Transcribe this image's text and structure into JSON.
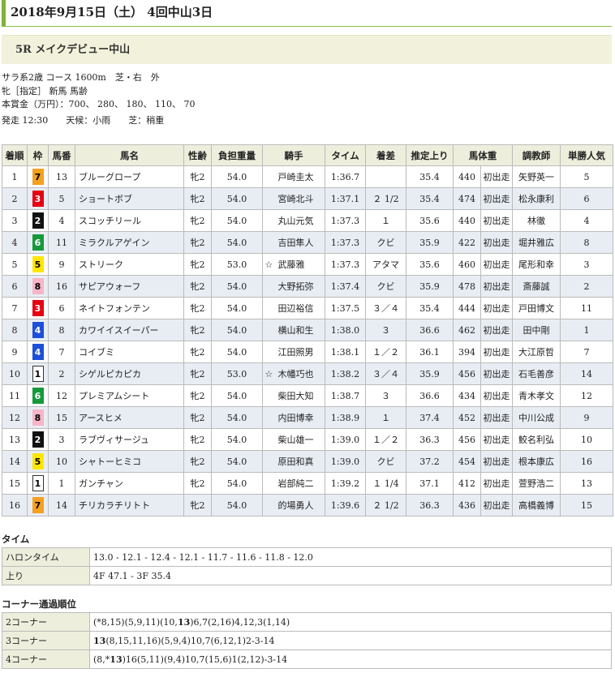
{
  "header": {
    "title": "2018年9月15日（土） 4回中山3日"
  },
  "race": {
    "title": "5R メイクデビュー中山",
    "info_lines": [
      "サラ系2歳 コース 1600m　芝・右　外",
      "牝［指定］ 新馬 馬齢",
      "本賞金（万円）：700、 280、 180、 110、 70",
      "発走 12:30　　天候：小雨　　芝：稍重"
    ]
  },
  "results": {
    "columns": [
      "着順",
      "枠",
      "馬番",
      "馬名",
      "性齢",
      "負担重量",
      "騎手",
      "タイム",
      "着差",
      "推定上り",
      "馬体重",
      "",
      "調教師",
      "単勝人気"
    ],
    "rows": [
      {
        "pos": "1",
        "waku": "7",
        "num": "13",
        "name": "ブルーグロープ",
        "sex": "牝2",
        "weight": "54.0",
        "mark": "",
        "jockey": "戸崎圭太",
        "time": "1:36.7",
        "margin": "",
        "last3f": "35.4",
        "body": "440",
        "bodychg": "初出走",
        "trainer": "矢野英一",
        "pop": "5"
      },
      {
        "pos": "2",
        "waku": "3",
        "num": "5",
        "name": "ショートボブ",
        "sex": "牝2",
        "weight": "54.0",
        "mark": "",
        "jockey": "宮崎北斗",
        "time": "1:37.1",
        "margin": "２ 1/2",
        "last3f": "35.4",
        "body": "474",
        "bodychg": "初出走",
        "trainer": "松永康利",
        "pop": "6"
      },
      {
        "pos": "3",
        "waku": "2",
        "num": "4",
        "name": "スコッチリール",
        "sex": "牝2",
        "weight": "54.0",
        "mark": "",
        "jockey": "丸山元気",
        "time": "1:37.3",
        "margin": "１",
        "last3f": "35.6",
        "body": "440",
        "bodychg": "初出走",
        "trainer": "林徹",
        "pop": "4"
      },
      {
        "pos": "4",
        "waku": "6",
        "num": "11",
        "name": "ミラクルアゲイン",
        "sex": "牝2",
        "weight": "54.0",
        "mark": "",
        "jockey": "吉田隼人",
        "time": "1:37.3",
        "margin": "クビ",
        "last3f": "35.9",
        "body": "422",
        "bodychg": "初出走",
        "trainer": "堀井雅広",
        "pop": "8"
      },
      {
        "pos": "5",
        "waku": "5",
        "num": "9",
        "name": "ストリーク",
        "sex": "牝2",
        "weight": "53.0",
        "mark": "☆",
        "jockey": "武藤雅",
        "time": "1:37.3",
        "margin": "アタマ",
        "last3f": "35.6",
        "body": "460",
        "bodychg": "初出走",
        "trainer": "尾形和幸",
        "pop": "3"
      },
      {
        "pos": "6",
        "waku": "8",
        "num": "16",
        "name": "サピアウォーフ",
        "sex": "牝2",
        "weight": "54.0",
        "mark": "",
        "jockey": "大野拓弥",
        "time": "1:37.4",
        "margin": "クビ",
        "last3f": "35.9",
        "body": "478",
        "bodychg": "初出走",
        "trainer": "斎藤誠",
        "pop": "2"
      },
      {
        "pos": "7",
        "waku": "3",
        "num": "6",
        "name": "ネイトフォンテン",
        "sex": "牝2",
        "weight": "54.0",
        "mark": "",
        "jockey": "田辺裕信",
        "time": "1:37.5",
        "margin": "３／４",
        "last3f": "35.4",
        "body": "444",
        "bodychg": "初出走",
        "trainer": "戸田博文",
        "pop": "11"
      },
      {
        "pos": "8",
        "waku": "4",
        "num": "8",
        "name": "カワイイスイーパー",
        "sex": "牝2",
        "weight": "54.0",
        "mark": "",
        "jockey": "横山和生",
        "time": "1:38.0",
        "margin": "３",
        "last3f": "36.6",
        "body": "462",
        "bodychg": "初出走",
        "trainer": "田中剛",
        "pop": "1"
      },
      {
        "pos": "9",
        "waku": "4",
        "num": "7",
        "name": "コイブミ",
        "sex": "牝2",
        "weight": "54.0",
        "mark": "",
        "jockey": "江田照男",
        "time": "1:38.1",
        "margin": "１／２",
        "last3f": "36.1",
        "body": "394",
        "bodychg": "初出走",
        "trainer": "大江原哲",
        "pop": "7"
      },
      {
        "pos": "10",
        "waku": "1",
        "num": "2",
        "name": "シゲルピカピカ",
        "sex": "牝2",
        "weight": "53.0",
        "mark": "☆",
        "jockey": "木幡巧也",
        "time": "1:38.2",
        "margin": "３／４",
        "last3f": "35.9",
        "body": "456",
        "bodychg": "初出走",
        "trainer": "石毛善彦",
        "pop": "14"
      },
      {
        "pos": "11",
        "waku": "6",
        "num": "12",
        "name": "プレミアムシート",
        "sex": "牝2",
        "weight": "54.0",
        "mark": "",
        "jockey": "柴田大知",
        "time": "1:38.7",
        "margin": "３",
        "last3f": "36.6",
        "body": "434",
        "bodychg": "初出走",
        "trainer": "青木孝文",
        "pop": "12"
      },
      {
        "pos": "12",
        "waku": "8",
        "num": "15",
        "name": "アースヒメ",
        "sex": "牝2",
        "weight": "54.0",
        "mark": "",
        "jockey": "内田博幸",
        "time": "1:38.9",
        "margin": "１",
        "last3f": "37.4",
        "body": "452",
        "bodychg": "初出走",
        "trainer": "中川公成",
        "pop": "9"
      },
      {
        "pos": "13",
        "waku": "2",
        "num": "3",
        "name": "ラブヴィサージュ",
        "sex": "牝2",
        "weight": "54.0",
        "mark": "",
        "jockey": "柴山雄一",
        "time": "1:39.0",
        "margin": "１／２",
        "last3f": "36.3",
        "body": "456",
        "bodychg": "初出走",
        "trainer": "鮫名利弘",
        "pop": "10"
      },
      {
        "pos": "14",
        "waku": "5",
        "num": "10",
        "name": "シャトーヒミコ",
        "sex": "牝2",
        "weight": "54.0",
        "mark": "",
        "jockey": "原田和真",
        "time": "1:39.0",
        "margin": "クビ",
        "last3f": "37.2",
        "body": "454",
        "bodychg": "初出走",
        "trainer": "根本康広",
        "pop": "16"
      },
      {
        "pos": "15",
        "waku": "1",
        "num": "1",
        "name": "ガンチャン",
        "sex": "牝2",
        "weight": "54.0",
        "mark": "",
        "jockey": "岩部純二",
        "time": "1:39.2",
        "margin": "１ 1/4",
        "last3f": "37.1",
        "body": "412",
        "bodychg": "初出走",
        "trainer": "萱野浩二",
        "pop": "13"
      },
      {
        "pos": "16",
        "waku": "7",
        "num": "14",
        "name": "チリカラチリトト",
        "sex": "牝2",
        "weight": "54.0",
        "mark": "",
        "jockey": "的場勇人",
        "time": "1:39.6",
        "margin": "２ 1/2",
        "last3f": "36.3",
        "body": "436",
        "bodychg": "初出走",
        "trainer": "高橋義博",
        "pop": "15"
      }
    ]
  },
  "waku_colors": {
    "1": {
      "bg": "#ffffff",
      "fg": "#000000",
      "border": "#333333"
    },
    "2": {
      "bg": "#111111",
      "fg": "#ffffff",
      "border": "#111111"
    },
    "3": {
      "bg": "#e60012",
      "fg": "#ffffff",
      "border": "#e60012"
    },
    "4": {
      "bg": "#1d4fd8",
      "fg": "#ffffff",
      "border": "#1d4fd8"
    },
    "5": {
      "bg": "#ffe600",
      "fg": "#000000",
      "border": "#ffe600"
    },
    "6": {
      "bg": "#149a3b",
      "fg": "#ffffff",
      "border": "#149a3b"
    },
    "7": {
      "bg": "#f5a01e",
      "fg": "#000000",
      "border": "#f5a01e"
    },
    "8": {
      "bg": "#f7b5c8",
      "fg": "#000000",
      "border": "#f7b5c8"
    }
  },
  "time_section": {
    "title": "タイム",
    "rows": [
      {
        "label": "ハロンタイム",
        "value": "13.0 - 12.1 - 12.4 - 12.1 - 11.7 - 11.6 - 11.8 - 12.0"
      },
      {
        "label": "上り",
        "value": "4F 47.1 - 3F 35.4"
      }
    ]
  },
  "corner_section": {
    "title": "コーナー通過順位",
    "rows": [
      {
        "label": "2コーナー",
        "parts": [
          {
            "t": "(*8,15)(5,9,11)(10,",
            "b": false
          },
          {
            "t": "13",
            "b": true
          },
          {
            "t": ")6,7(2,16)4,12,3(1,14)",
            "b": false
          }
        ]
      },
      {
        "label": "3コーナー",
        "parts": [
          {
            "t": "13",
            "b": true
          },
          {
            "t": "(8,15,11,16)(5,9,4)10,7(6,12,1)2-3-14",
            "b": false
          }
        ]
      },
      {
        "label": "4コーナー",
        "parts": [
          {
            "t": "(8,*",
            "b": false
          },
          {
            "t": "13",
            "b": true
          },
          {
            "t": ")16(5,11)(9,4)10,7(15,6)1(2,12)-3-14",
            "b": false
          }
        ]
      }
    ]
  }
}
